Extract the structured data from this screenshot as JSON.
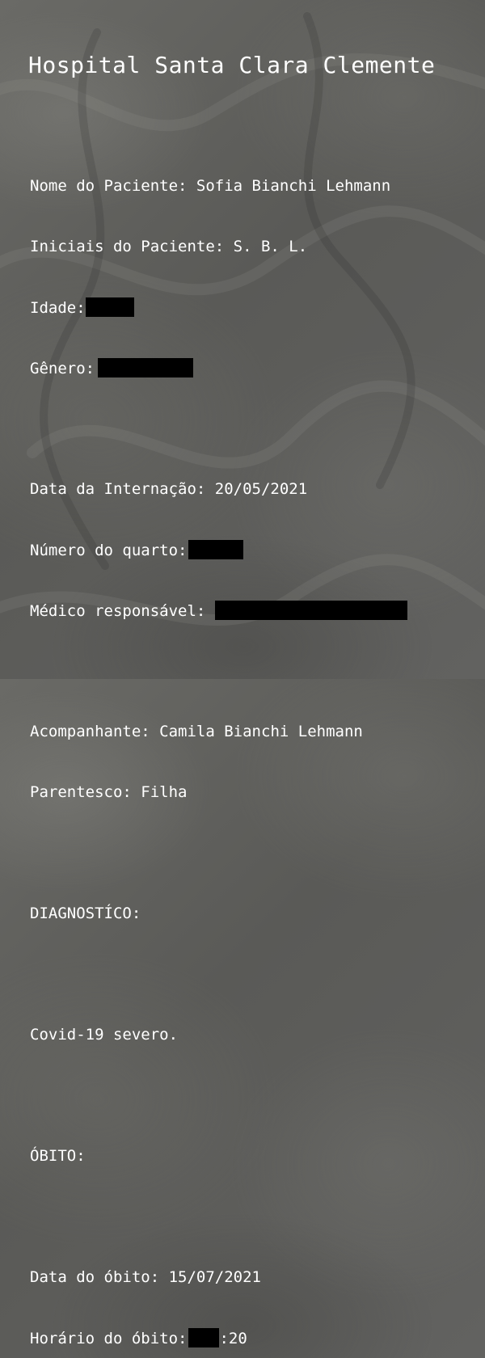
{
  "title": "Hospital Santa Clara Clemente",
  "patient": {
    "name_label": "Nome do Paciente:",
    "name_value": "Sofia Bianchi Lehmann",
    "initials_label": "Iniciais do Paciente:",
    "initials_value": "S. B. L.",
    "age_label": "Idade:",
    "gender_label": "Gênero:"
  },
  "admission": {
    "date_label": "Data da Internação:",
    "date_value": "20/05/2021",
    "room_label": "Número do quarto:",
    "doctor_label": "Médico responsável:"
  },
  "companion": {
    "name_label": "Acompanhante:",
    "name_value": "Camila Bianchi Lehmann",
    "relation_label": "Parentesco:",
    "relation_value": "Filha"
  },
  "diagnosis": {
    "heading": "DIAGNOSTÍCO:",
    "text": "Covid-19 severo."
  },
  "death": {
    "heading": "ÓBITO:",
    "date_label": "Data do óbito:",
    "date_value": "15/07/2021",
    "time_label": "Horário do óbito:",
    "time_suffix": ":20"
  }
}
